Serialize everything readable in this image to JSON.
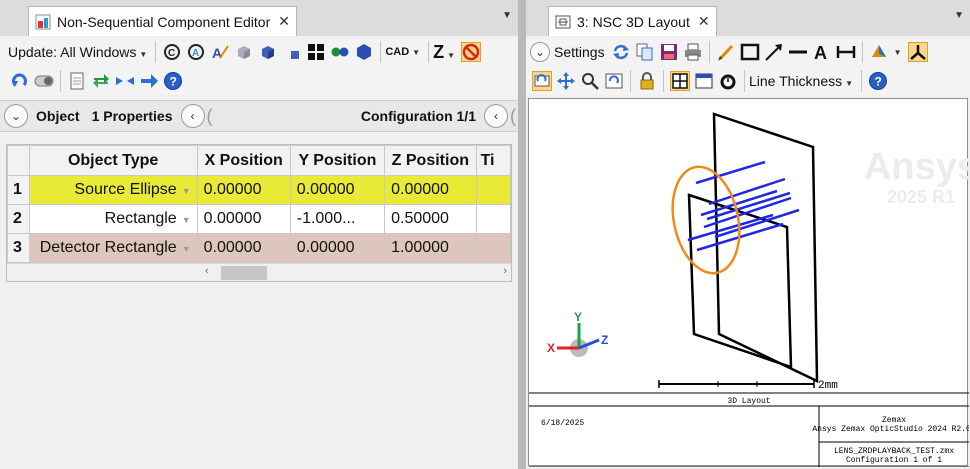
{
  "left_window": {
    "tab_title": "Non-Sequential Component Editor",
    "toolbar": {
      "update_label": "Update: All Windows",
      "cad_label": "CAD",
      "z_label": "Z"
    },
    "header": {
      "object_label": "Object",
      "properties_label": "1 Properties",
      "configuration_label": "Configuration 1/1"
    },
    "table": {
      "columns": [
        "",
        "Object Type",
        "X Position",
        "Y Position",
        "Z Position",
        "Ti"
      ],
      "rows": [
        {
          "num": "1",
          "type": "Source Ellipse",
          "x": "0.00000",
          "y": "0.00000",
          "z": "0.00000"
        },
        {
          "num": "2",
          "type": "Rectangle",
          "x": "0.00000",
          "y": "-1.000...",
          "z": "0.50000"
        },
        {
          "num": "3",
          "type": "Detector Rectangle",
          "x": "0.00000",
          "y": "0.00000",
          "z": "1.00000"
        }
      ],
      "row_colors": [
        "#e8ea35",
        "#ffffff",
        "#ddc7bc"
      ]
    }
  },
  "right_window": {
    "tab_title": "3: NSC 3D Layout",
    "toolbar": {
      "settings_label": "Settings",
      "line_thickness_label": "Line Thickness"
    },
    "watermark": {
      "brand": "Ansys",
      "version": "2025 R1"
    },
    "scale_bar_label": "2mm",
    "axes": {
      "x": "X",
      "y": "Y",
      "z": "Z"
    },
    "footer": {
      "caption": "3D Layout",
      "date": "6/18/2025",
      "company": "Zemax",
      "product": "Ansys Zemax OpticStudio 2024 R2.02",
      "file": "LENS_ZRDPLAYBACK_TEST.zmx",
      "config": "Configuration 1 of 1"
    }
  },
  "colors": {
    "source_ellipse": "#f08a1a",
    "rays": "#1e28e6",
    "highlight_row": "#e8ea35",
    "detector_row": "#ddc7bc"
  }
}
